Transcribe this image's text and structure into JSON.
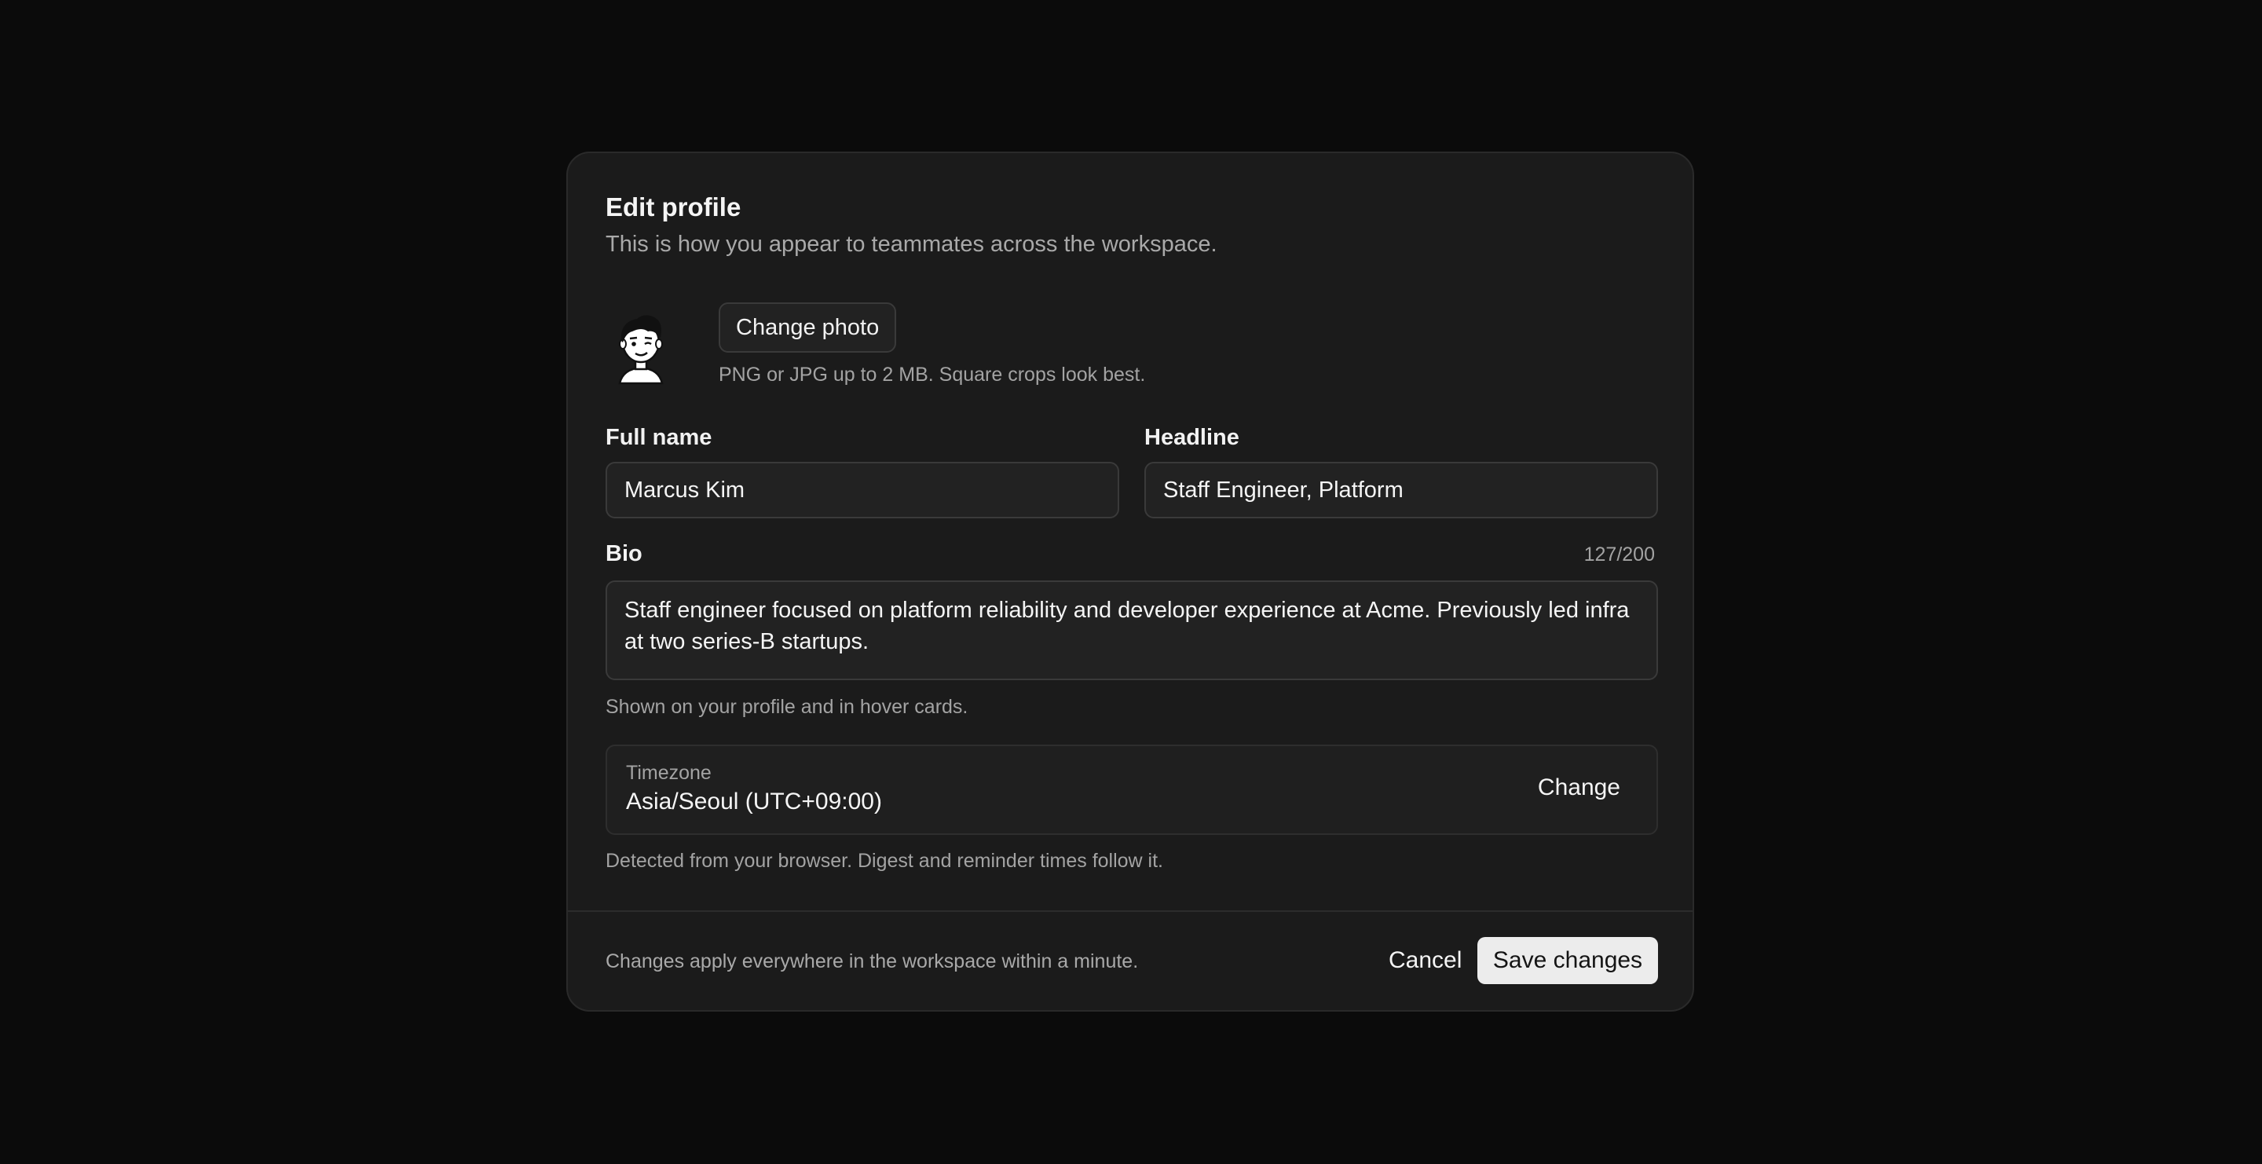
{
  "dialog": {
    "title": "Edit profile",
    "subtitle": "This is how you appear to teammates across the workspace."
  },
  "photo": {
    "avatar_icon": "avatar-illustration",
    "change_label": "Change photo",
    "hint": "PNG or JPG up to 2 MB. Square crops look best."
  },
  "fields": {
    "full_name": {
      "label": "Full name",
      "value": "Marcus Kim"
    },
    "headline": {
      "label": "Headline",
      "value": "Staff Engineer, Platform"
    },
    "bio": {
      "label": "Bio",
      "counter": "127/200",
      "value": "Staff engineer focused on platform reliability and developer experience at Acme. Previously led infra at two series-B startups.",
      "hint": "Shown on your profile and in hover cards."
    }
  },
  "timezone": {
    "label": "Timezone",
    "value": "Asia/Seoul (UTC+09:00)",
    "change_label": "Change",
    "hint": "Detected from your browser. Digest and reminder times follow it."
  },
  "footer": {
    "note": "Changes apply everywhere in the workspace within a minute.",
    "cancel_label": "Cancel",
    "save_label": "Save changes"
  },
  "colors": {
    "background": "#0b0b0b",
    "dialog": "#1b1b1b",
    "input": "#222222",
    "primary_button": "#ececec"
  }
}
